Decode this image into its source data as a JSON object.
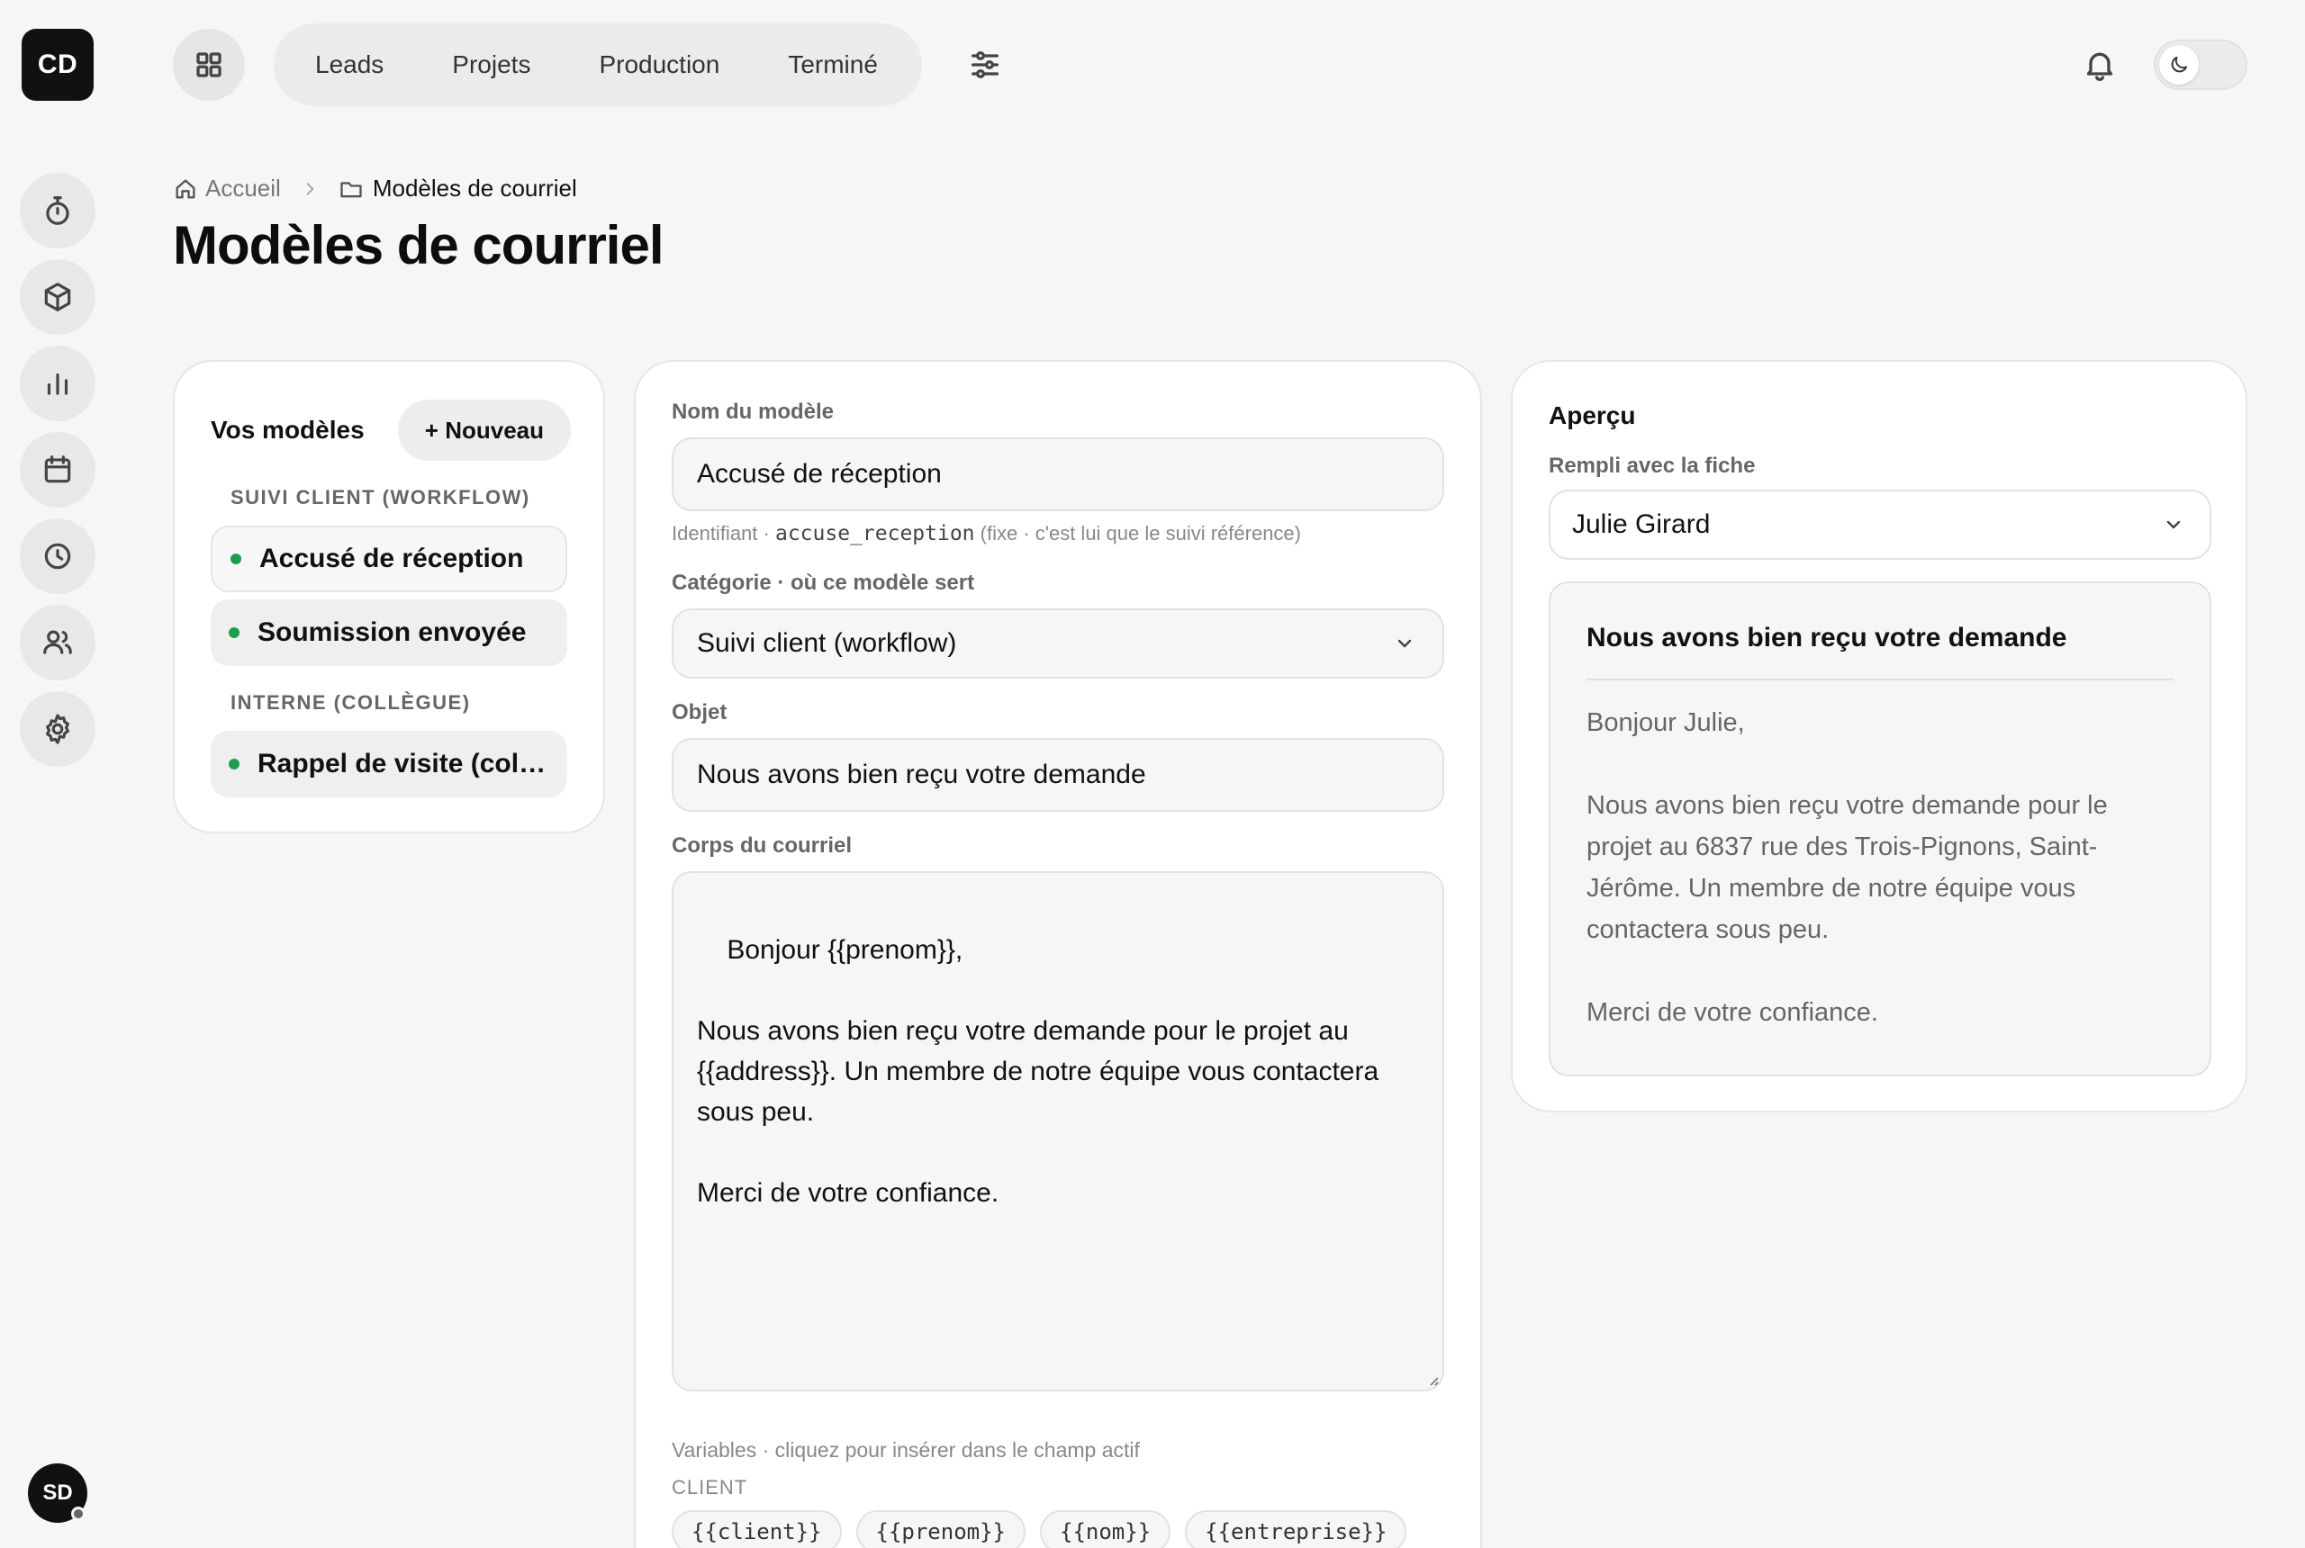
{
  "brand": {
    "initials": "CD"
  },
  "user": {
    "initials": "SD"
  },
  "topnav": {
    "items": [
      "Leads",
      "Projets",
      "Production",
      "Terminé"
    ]
  },
  "breadcrumb": {
    "home": "Accueil",
    "current": "Modèles de courriel"
  },
  "page": {
    "title": "Modèles de courriel"
  },
  "templates": {
    "title": "Vos modèles",
    "new_label": "+ Nouveau",
    "groups": [
      {
        "label": "SUIVI CLIENT (WORKFLOW)",
        "items": [
          "Accusé de réception",
          "Soumission envoyée"
        ]
      },
      {
        "label": "INTERNE (COLLÈGUE)",
        "items": [
          "Rappel de visite (col…"
        ]
      }
    ]
  },
  "form": {
    "name_label": "Nom du modèle",
    "name_value": "Accusé de réception",
    "id_hint_prefix": "Identifiant ·",
    "id_value": "accuse_reception",
    "id_hint_suffix": "(fixe · c'est lui que le suivi référence)",
    "category_label": "Catégorie · où ce modèle sert",
    "category_value": "Suivi client (workflow)",
    "subject_label": "Objet",
    "subject_value": "Nous avons bien reçu votre demande",
    "body_label": "Corps du courriel",
    "body_value": "Bonjour {{prenom}},\n\nNous avons bien reçu votre demande pour le projet au\n{{address}}. Un membre de notre équipe vous contactera\nsous peu.\n\nMerci de votre confiance.",
    "vars_hint": "Variables · cliquez pour insérer dans le champ actif",
    "vars_group": "CLIENT",
    "vars": [
      "{{client}}",
      "{{prenom}}",
      "{{nom}}",
      "{{entreprise}}"
    ]
  },
  "preview": {
    "title": "Aperçu",
    "filled_label": "Rempli avec la fiche",
    "record_value": "Julie Girard",
    "subject": "Nous avons bien reçu votre demande",
    "body": "Bonjour Julie,\n\nNous avons bien reçu votre demande pour le\nprojet au 6837 rue des Trois-Pignons, Saint-\nJérôme. Un membre de notre équipe vous\ncontactera sous peu.\n\nMerci de votre confiance."
  },
  "colors": {
    "status_dot": "#1f9d4e",
    "brand_bg": "#111111"
  }
}
